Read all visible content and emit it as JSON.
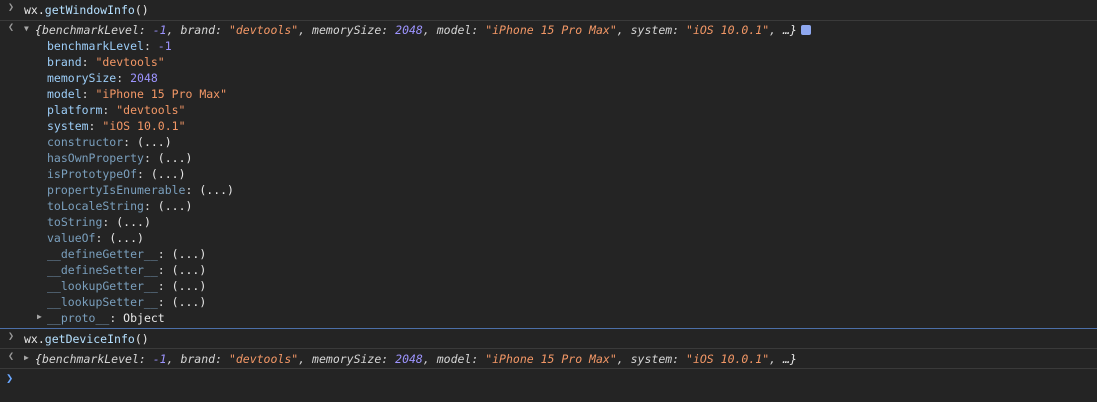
{
  "commands": {
    "first": {
      "obj": "wx",
      "fn": "getWindowInfo",
      "call": "()"
    },
    "second": {
      "obj": "wx",
      "fn": "getDeviceInfo",
      "call": "()"
    }
  },
  "summary": {
    "open": "{",
    "close": "…}",
    "k1": "benchmarkLevel",
    "v1": "-1",
    "k2": "brand",
    "v2": "\"devtools\"",
    "k3": "memorySize",
    "v3": "2048",
    "k4": "model",
    "v4": "\"iPhone 15 Pro Max\"",
    "k5": "system",
    "v5": "\"iOS 10.0.1\""
  },
  "properties": [
    {
      "key": "benchmarkLevel",
      "value": "-1",
      "type": "num"
    },
    {
      "key": "brand",
      "value": "\"devtools\"",
      "type": "str"
    },
    {
      "key": "memorySize",
      "value": "2048",
      "type": "num"
    },
    {
      "key": "model",
      "value": "\"iPhone 15 Pro Max\"",
      "type": "str"
    },
    {
      "key": "platform",
      "value": "\"devtools\"",
      "type": "str"
    },
    {
      "key": "system",
      "value": "\"iOS 10.0.1\"",
      "type": "str"
    }
  ],
  "proto_methods": [
    {
      "key": "constructor",
      "value": "(...)"
    },
    {
      "key": "hasOwnProperty",
      "value": "(...)"
    },
    {
      "key": "isPrototypeOf",
      "value": "(...)"
    },
    {
      "key": "propertyIsEnumerable",
      "value": "(...)"
    },
    {
      "key": "toLocaleString",
      "value": "(...)"
    },
    {
      "key": "toString",
      "value": "(...)"
    },
    {
      "key": "valueOf",
      "value": "(...)"
    },
    {
      "key": "__defineGetter__",
      "value": "(...)"
    },
    {
      "key": "__defineSetter__",
      "value": "(...)"
    },
    {
      "key": "__lookupGetter__",
      "value": "(...)"
    },
    {
      "key": "__lookupSetter__",
      "value": "(...)"
    }
  ],
  "proto": {
    "key": "__proto__",
    "value": "Object"
  },
  "colors": {
    "background": "#242424",
    "string": "#f29766",
    "number": "#9d94ff",
    "key": "#9ccdf7",
    "dim_key": "#7a9fbd",
    "prompt": "#6aa7ff"
  },
  "icons": {
    "input_marker": "chevron-right-icon",
    "output_marker": "chevron-left-icon",
    "expanded": "triangle-down-icon",
    "collapsed": "triangle-right-icon",
    "info": "info-badge-icon"
  }
}
